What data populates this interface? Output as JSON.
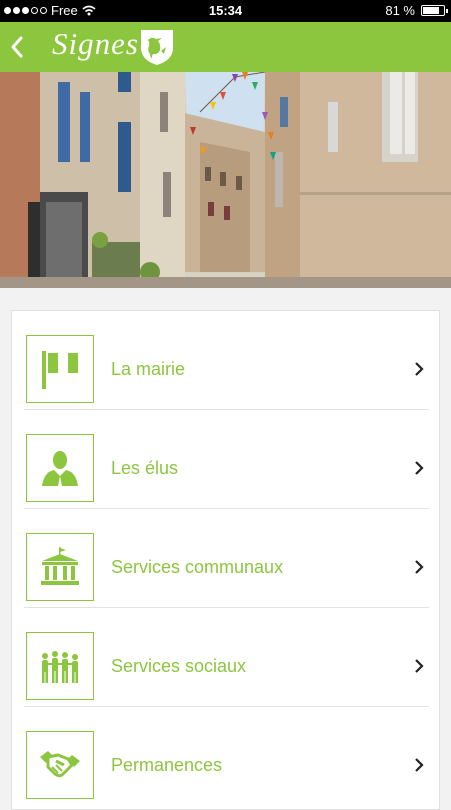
{
  "status_bar": {
    "carrier": "Free",
    "time": "15:34",
    "battery": "81 %",
    "battery_level": 0.81
  },
  "header": {
    "app_name": "Signes",
    "accent_color": "#8cc63f"
  },
  "menu": {
    "items": [
      {
        "label": "La mairie",
        "icon": "flag-icon"
      },
      {
        "label": "Les élus",
        "icon": "person-icon"
      },
      {
        "label": "Services communaux",
        "icon": "townhall-icon"
      },
      {
        "label": "Services sociaux",
        "icon": "people-icon"
      },
      {
        "label": "Permanences",
        "icon": "handshake-icon"
      }
    ]
  }
}
